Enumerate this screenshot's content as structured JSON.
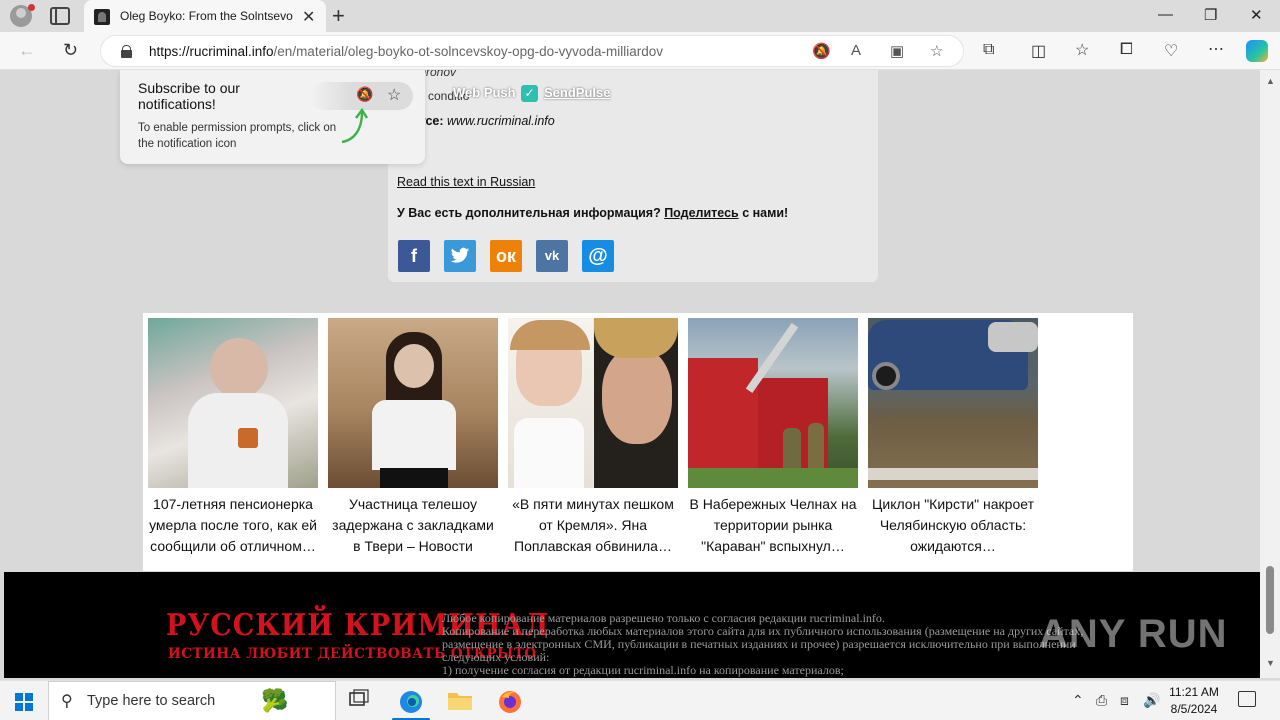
{
  "browser": {
    "tab_title": "Oleg Boyko: From the Solntsevo",
    "url_host": "https://rucriminal.info",
    "url_path": "/en/material/oleg-boyko-ot-solncevskoy-opg-do-vyvoda-milliardov"
  },
  "notification_popup": {
    "title": "Subscribe to our notifications!",
    "text": "To enable permission prompts, click on the notification icon"
  },
  "webpush": {
    "label": "Web Push",
    "brand": "SendPulse"
  },
  "article": {
    "byline_partial": "y Dronov",
    "conditions_partial": "e conditio",
    "source_label": "Source:",
    "source_value": "www.rucriminal.info",
    "read_link": "Read this text in Russian",
    "ask_text": "У Вас есть дополнительная информация?",
    "ask_link": "Поделитесь",
    "ask_tail": "с нами!",
    "social": [
      {
        "name": "facebook",
        "glyph": "f"
      },
      {
        "name": "twitter",
        "glyph": "t"
      },
      {
        "name": "odnoklassniki",
        "glyph": "ок"
      },
      {
        "name": "vkontakte",
        "glyph": "vk"
      },
      {
        "name": "mail",
        "glyph": "@"
      }
    ]
  },
  "news": [
    {
      "title": "107-летняя пенсионерка умерла после того, как ей сообщили об отличном…"
    },
    {
      "title": "Участница телешоу задержана с закладками в Твери – Новости Твери…"
    },
    {
      "title": "«В пяти минутах пешком от Кремля». Яна Поплавская обвинила…"
    },
    {
      "title": "В Набережных Челнах на территории рынка \"Караван\" вспыхнул…"
    },
    {
      "title": "Циклон \"Кирсти\" накроет Челябинскую область: ожидаются…"
    }
  ],
  "footer": {
    "logo_main": "РУССКИЙ КРИМИНАЛ",
    "logo_sub": "ИСТИНА ЛЮБИТ ДЕЙСТВОВАТЬ ОТКРЫТО",
    "lines": [
      "Любое копирование материалов разрешено только с согласия редакции rucriminal.info.",
      "Копирование и переработка любых материалов этого сайта для их публичного использования (размещение на других сайтах, размещение в электронных СМИ, публикации в печатных изданиях и прочее) разрешается исключительно при выполнении следующих условий:",
      "1) получение согласия от редакции rucriminal.info на копирование материалов;"
    ],
    "watermark": "ANY RUN"
  },
  "taskbar": {
    "search_placeholder": "Type here to search",
    "time": "11:21 AM",
    "date": "8/5/2024"
  },
  "colors": {
    "accent": "#0078d4",
    "logo_red": "#d3121b",
    "facebook": "#3b5998",
    "twitter": "#3a9ad9",
    "ok": "#ee8208",
    "vk": "#4c75a3",
    "mail": "#168de2"
  }
}
